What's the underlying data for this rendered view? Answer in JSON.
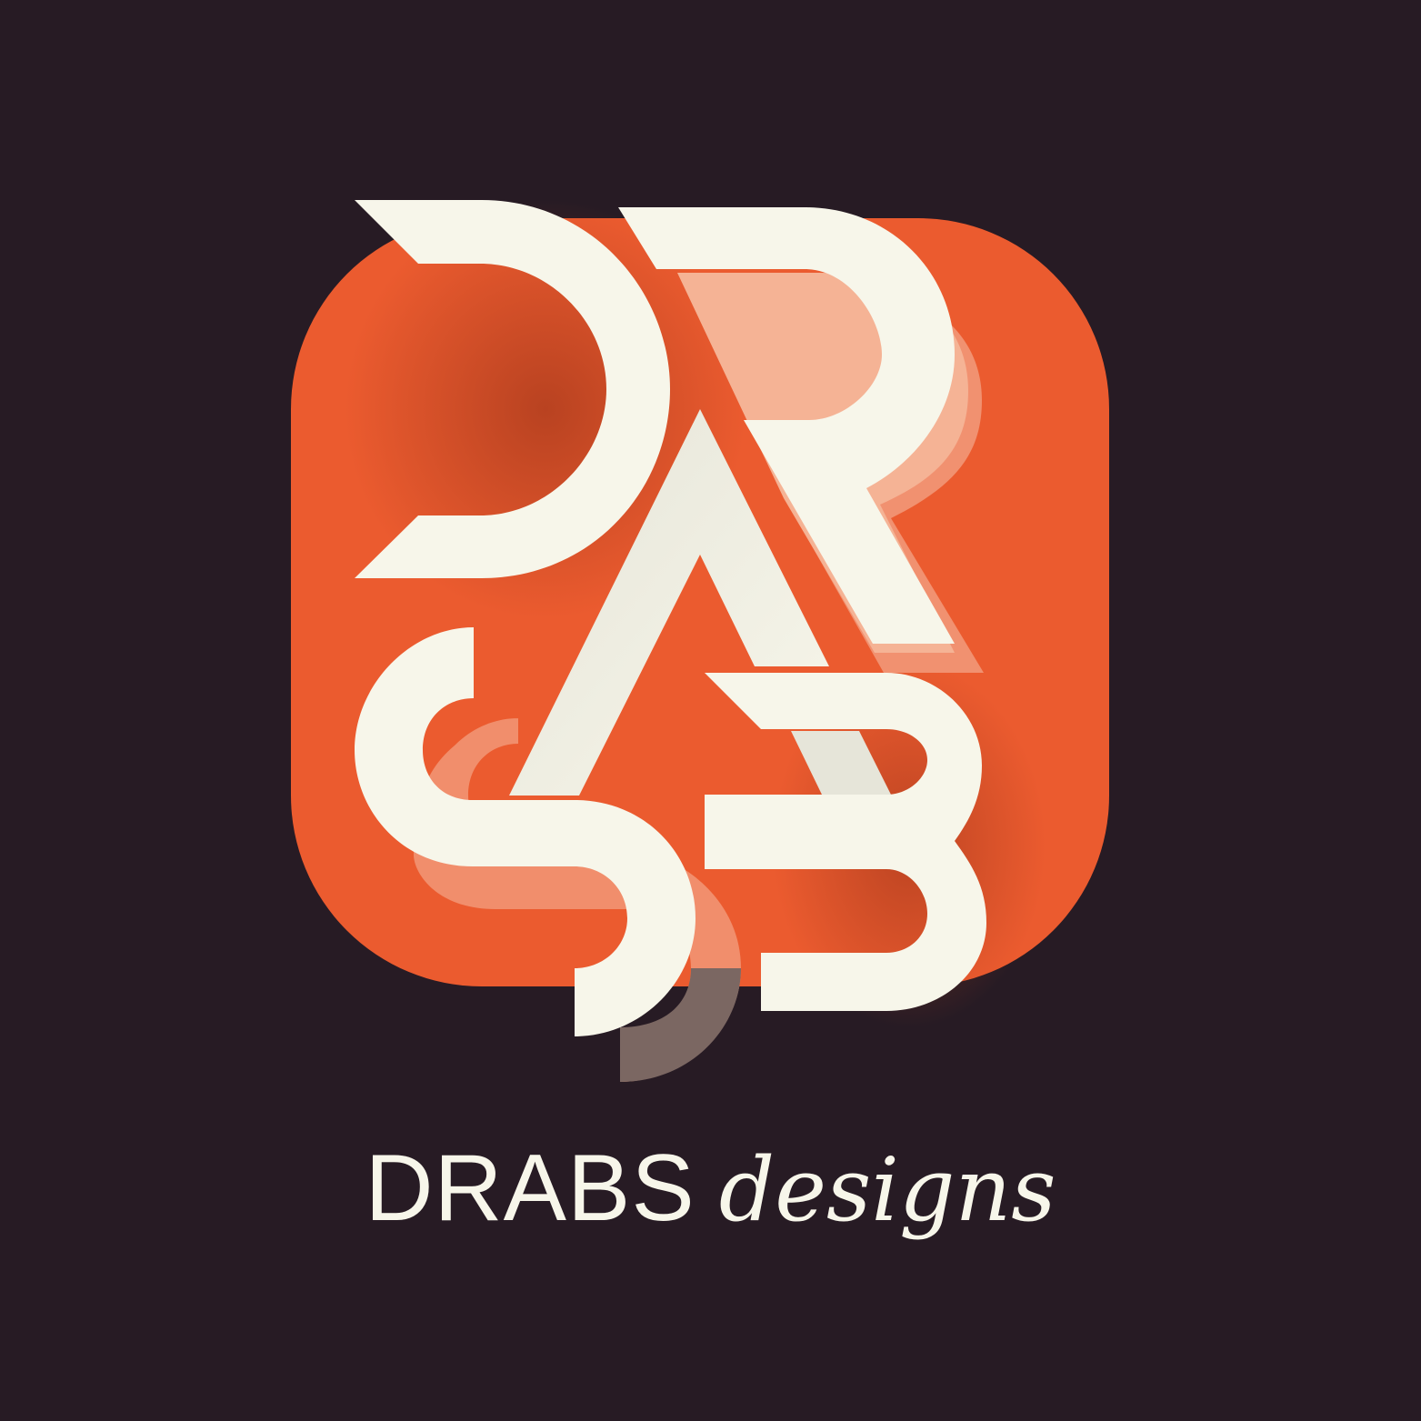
{
  "brand": {
    "monogram_letters": [
      "D",
      "R",
      "A",
      "S",
      "B"
    ],
    "name_primary": "DRABS",
    "name_secondary": "designs"
  },
  "colors": {
    "background": "#271b24",
    "badge": "#eb5b2f",
    "letters": "#f7f6ea",
    "echo_light": "#f5b395",
    "echo_mid": "#f19170",
    "echo_dark": "#7b6762",
    "shade": "#b6401f"
  }
}
